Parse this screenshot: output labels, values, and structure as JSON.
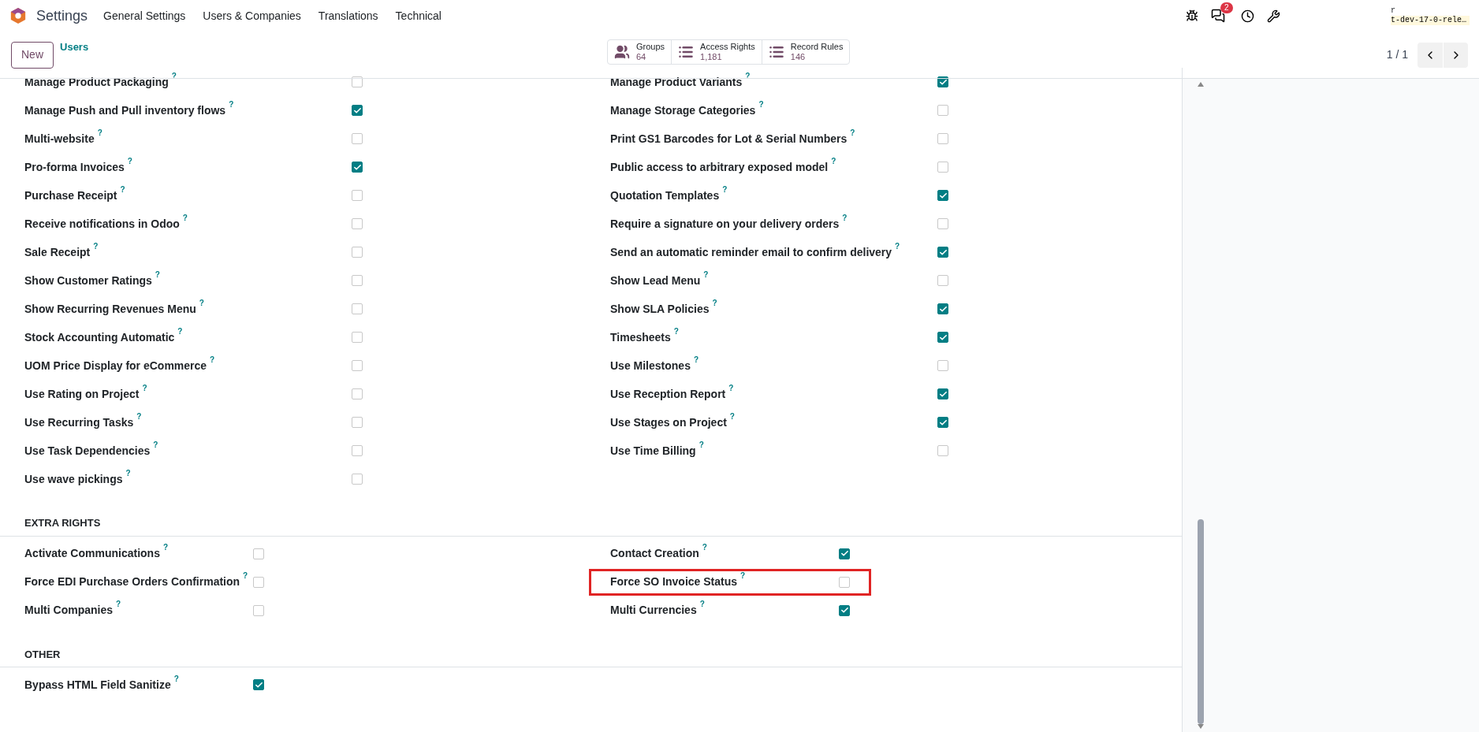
{
  "navbar": {
    "app": "Settings",
    "menu": [
      "General Settings",
      "Users & Companies",
      "Translations",
      "Technical"
    ],
    "chat_count": "2",
    "db_line1": "r",
    "db_line2": "t-dev-17-0-rele…"
  },
  "control_panel": {
    "new_button": "New",
    "breadcrumb": "Users",
    "stats": [
      {
        "label": "Groups",
        "value": "64"
      },
      {
        "label": "Access Rights",
        "value": "1,181"
      },
      {
        "label": "Record Rules",
        "value": "146"
      }
    ],
    "pager": "1 / 1"
  },
  "sections": [
    {
      "left": [
        {
          "label": "Manage Product Packaging",
          "help": "?",
          "checked": false
        },
        {
          "label": "Manage Push and Pull inventory flows",
          "help": "?",
          "checked": true
        },
        {
          "label": "Multi-website",
          "help": "?",
          "checked": false
        },
        {
          "label": "Pro-forma Invoices",
          "help": "?",
          "checked": true
        },
        {
          "label": "Purchase Receipt",
          "help": "?",
          "checked": false
        },
        {
          "label": "Receive notifications in Odoo",
          "help": "?",
          "checked": false
        },
        {
          "label": "Sale Receipt",
          "help": "?",
          "checked": false
        },
        {
          "label": "Show Customer Ratings",
          "help": "?",
          "checked": false
        },
        {
          "label": "Show Recurring Revenues Menu",
          "help": "?",
          "checked": false
        },
        {
          "label": "Stock Accounting Automatic",
          "help": "?",
          "checked": false
        },
        {
          "label": "UOM Price Display for eCommerce",
          "help": "?",
          "checked": false
        },
        {
          "label": "Use Rating on Project",
          "help": "?",
          "checked": false
        },
        {
          "label": "Use Recurring Tasks",
          "help": "?",
          "checked": false
        },
        {
          "label": "Use Task Dependencies",
          "help": "?",
          "checked": false
        },
        {
          "label": "Use wave pickings",
          "help": "?",
          "checked": false
        }
      ],
      "right": [
        {
          "label": "Manage Product Variants",
          "help": "?",
          "checked": true
        },
        {
          "label": "Manage Storage Categories",
          "help": "?",
          "checked": false
        },
        {
          "label": "Print GS1 Barcodes for Lot & Serial Numbers",
          "help": "?",
          "checked": false
        },
        {
          "label": "Public access to arbitrary exposed model",
          "help": "?",
          "checked": false
        },
        {
          "label": "Quotation Templates",
          "help": "?",
          "checked": true
        },
        {
          "label": "Require a signature on your delivery orders",
          "help": "?",
          "checked": false
        },
        {
          "label": "Send an automatic reminder email to confirm delivery",
          "help": "?",
          "checked": true
        },
        {
          "label": "Show Lead Menu",
          "help": "?",
          "checked": false
        },
        {
          "label": "Show SLA Policies",
          "help": "?",
          "checked": true
        },
        {
          "label": "Timesheets",
          "help": "?",
          "checked": true
        },
        {
          "label": "Use Milestones",
          "help": "?",
          "checked": false
        },
        {
          "label": "Use Reception Report",
          "help": "?",
          "checked": true
        },
        {
          "label": "Use Stages on Project",
          "help": "?",
          "checked": true
        },
        {
          "label": "Use Time Billing",
          "help": "?",
          "checked": false
        }
      ]
    },
    {
      "title": "EXTRA RIGHTS",
      "left": [
        {
          "label": "Activate Communications",
          "help": "?",
          "checked": false
        },
        {
          "label": "Force EDI Purchase Orders Confirmation",
          "help": "?",
          "checked": false
        },
        {
          "label": "Multi Companies",
          "help": "?",
          "checked": false
        }
      ],
      "right": [
        {
          "label": "Contact Creation",
          "help": "?",
          "checked": true
        },
        {
          "label": "Force SO Invoice Status",
          "help": "?",
          "checked": false,
          "highlighted": true
        },
        {
          "label": "Multi Currencies",
          "help": "?",
          "checked": true
        }
      ]
    },
    {
      "title": "OTHER",
      "left": [
        {
          "label": "Bypass HTML Field Sanitize",
          "help": "?",
          "checked": true
        }
      ]
    }
  ]
}
